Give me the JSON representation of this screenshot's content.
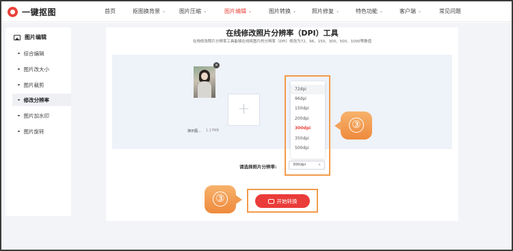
{
  "header": {
    "logo_text": "一键抠图",
    "nav": [
      {
        "label": "首页",
        "caret": false,
        "active": false
      },
      {
        "label": "抠图换背景",
        "caret": true,
        "active": false
      },
      {
        "label": "图片压缩",
        "caret": true,
        "active": false
      },
      {
        "label": "图片编辑",
        "caret": true,
        "active": true
      },
      {
        "label": "图片转换",
        "caret": true,
        "active": false
      },
      {
        "label": "照片修复",
        "caret": true,
        "active": false
      },
      {
        "label": "特色功能",
        "caret": true,
        "active": false
      },
      {
        "label": "客户端",
        "caret": true,
        "active": false
      },
      {
        "label": "常见问题",
        "caret": false,
        "active": false
      }
    ],
    "caret_glyph": "⌄"
  },
  "sidebar": {
    "title": "图片编辑",
    "items": [
      {
        "label": "综合编辑",
        "active": false
      },
      {
        "label": "图片改大小",
        "active": false
      },
      {
        "label": "图片裁剪",
        "active": false
      },
      {
        "label": "修改分辨率",
        "active": true
      },
      {
        "label": "图片加水印",
        "active": false
      },
      {
        "label": "图片旋转",
        "active": false
      }
    ]
  },
  "main": {
    "title": "在线修改照片分辨率（DPI）工具",
    "subtitle": "在线修改照片分辨率工具能够在线将图片的分辨率（DPI）修改为72、96、150、300、500、1000等数值",
    "file": {
      "name": "演示图...",
      "size": "1.17MB"
    },
    "remove_glyph": "✕",
    "add_glyph": "+",
    "dpi_options": [
      "72dpi",
      "96dpi",
      "150dpi",
      "200dpi",
      "300dpi",
      "350dpi",
      "500dpi"
    ],
    "selected_option": "300dpi",
    "hover_option": "72dpi",
    "select_label": "请选择照片分辨率:",
    "select_value": "300dpi",
    "select_chevron": "∨",
    "start_button": "开始转换"
  },
  "callouts": [
    {
      "number": "③"
    },
    {
      "number": "③"
    }
  ],
  "colors": {
    "accent": "#e8433a",
    "highlight": "#f29a4a",
    "callout": "#ef8f42"
  }
}
